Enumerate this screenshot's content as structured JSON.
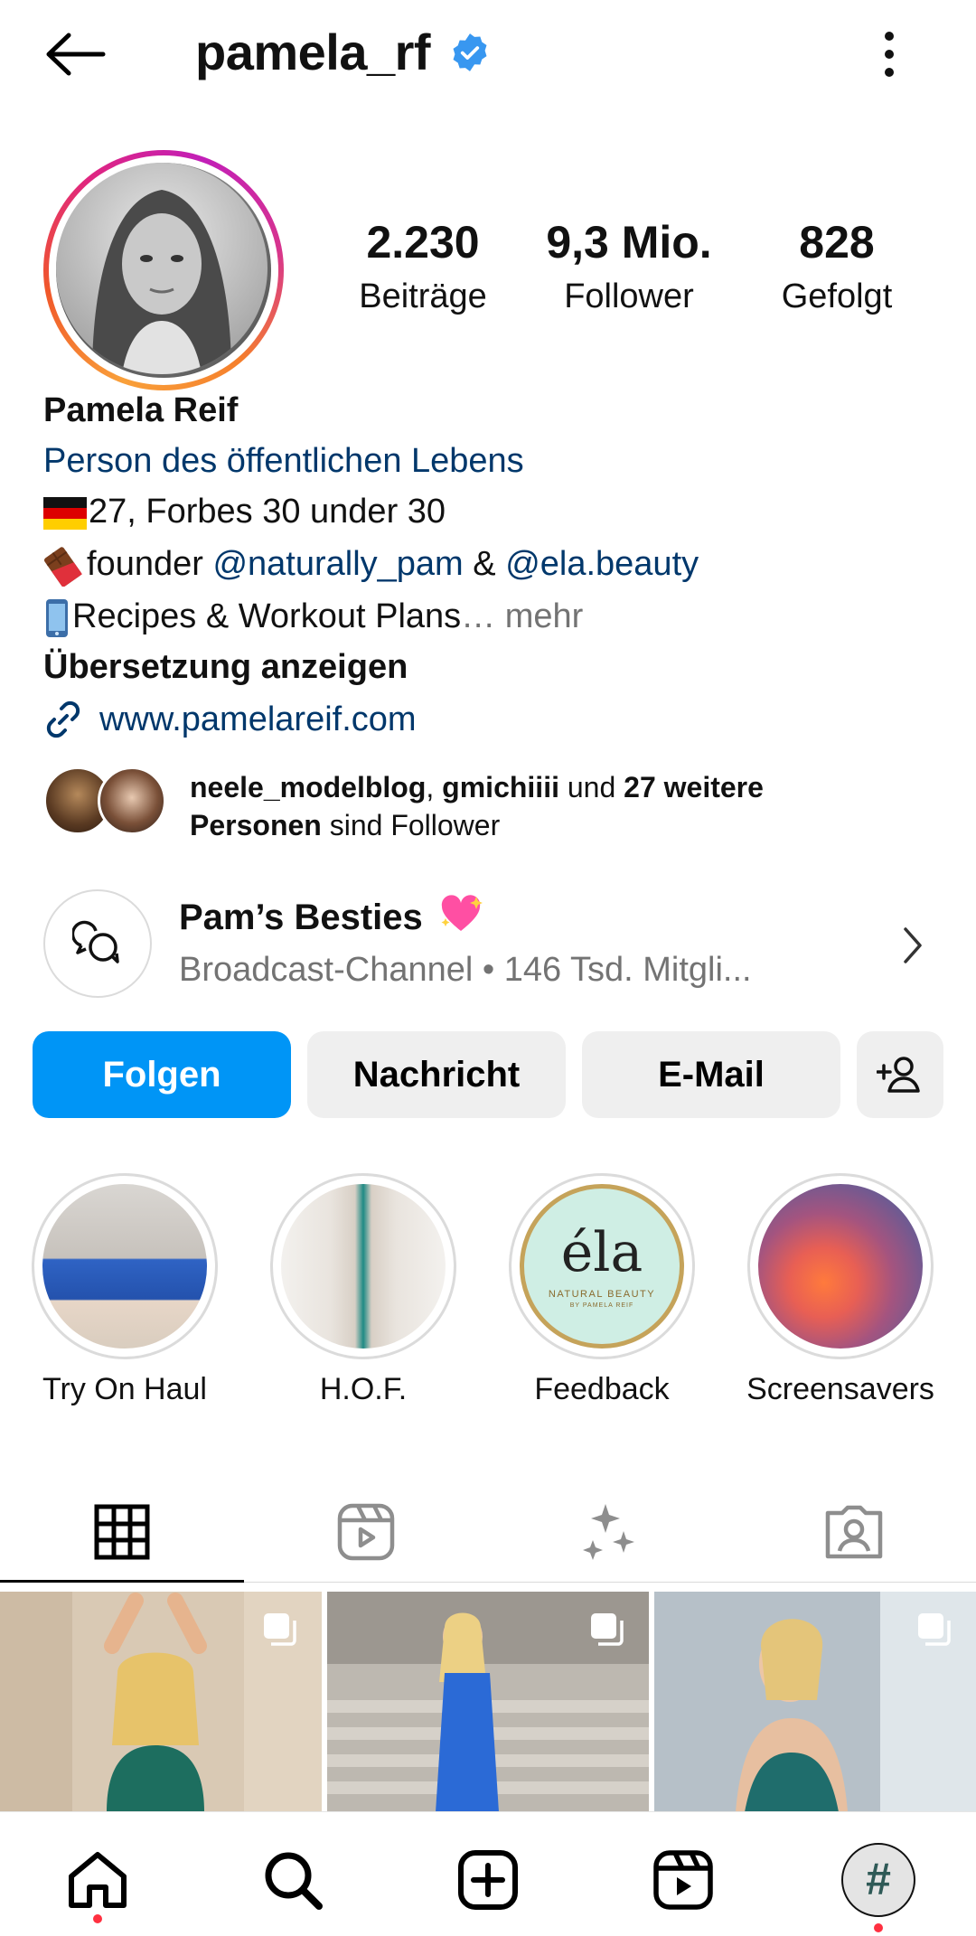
{
  "header": {
    "username": "pamela_rf",
    "verified_color": "#3897f0"
  },
  "stats": [
    {
      "value": "2.230",
      "label": "Beiträge"
    },
    {
      "value": "9,3 Mio.",
      "label": "Follower"
    },
    {
      "value": "828",
      "label": "Gefolgt"
    }
  ],
  "bio": {
    "name": "Pamela Reif",
    "category": "Person des öffentlichen Lebens",
    "line1": "27, Forbes 30 under 30",
    "line2_prefix": "founder ",
    "line2_mention1": "@naturally_pam",
    "line2_amp": " & ",
    "line2_mention2": "@ela.beauty",
    "line3": "Recipes & Workout Plans",
    "line3_more": "… mehr",
    "translate": "Übersetzung anzeigen",
    "link": "www.pamelareif.com"
  },
  "followed_by": {
    "name1": "neele_modelblog",
    "sep": ", ",
    "name2": "gmichiiii",
    "mid": " und ",
    "count": "27 weitere",
    "count2": "Personen",
    "suffix": " sind Follower"
  },
  "broadcast": {
    "title": "Pam’s Besties",
    "subtitle": "Broadcast-Channel • 146 Tsd. Mitgli..."
  },
  "buttons": {
    "follow": "Folgen",
    "message": "Nachricht",
    "email": "E-Mail"
  },
  "highlights": [
    {
      "label": "Try On Haul"
    },
    {
      "label": "H.O.F."
    },
    {
      "label": "Feedback",
      "logo_text": "éla",
      "logo_sub": "NATURAL BEAUTY",
      "logo_sub2": "BY PAMELA REIF"
    },
    {
      "label": "Screensavers"
    }
  ],
  "tabs": [
    "grid-icon",
    "reels-icon",
    "sparkles-icon",
    "tagged-icon"
  ],
  "nav": [
    "home-icon",
    "search-icon",
    "create-icon",
    "reels-icon",
    "profile-avatar"
  ],
  "colors": {
    "accent": "#0095f6",
    "link": "#00376b",
    "muted": "#737373",
    "notification": "#ff3040"
  }
}
